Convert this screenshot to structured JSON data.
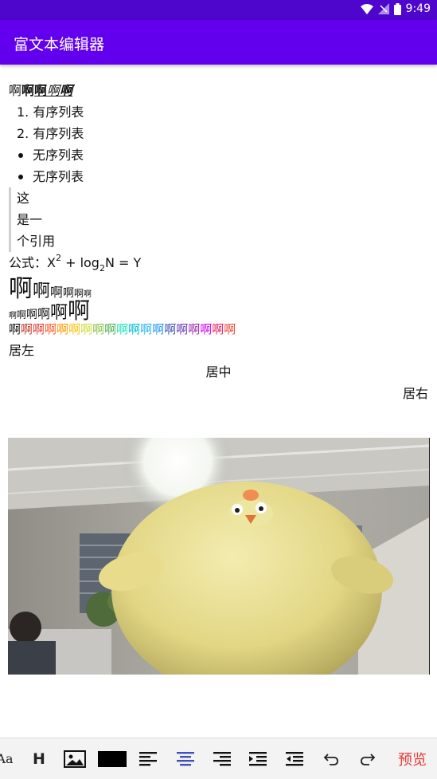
{
  "status": {
    "time": "9:49"
  },
  "app": {
    "title": "富文本编辑器"
  },
  "editor": {
    "mixed": {
      "normal": "啊",
      "bold": "啊",
      "bold_underline": "啊",
      "italic1": "啊",
      "italic2": "啊"
    },
    "ordered": [
      {
        "num": "1.",
        "text": "有序列表"
      },
      {
        "num": "2.",
        "text": "有序列表"
      }
    ],
    "unordered": [
      "无序列表",
      "无序列表"
    ],
    "quote": [
      "这",
      "是一",
      "个引用"
    ],
    "formula": {
      "prefix": "公式：",
      "X": "X",
      "exp": "2",
      "plus": " + log",
      "sub": "2",
      "rest": "N = Y"
    },
    "shrink": [
      "啊",
      "啊",
      "啊",
      "啊",
      "啊",
      "啊"
    ],
    "grow": [
      "啊",
      "啊",
      "啊",
      "啊",
      "啊",
      "啊"
    ],
    "colored": [
      "啊",
      "啊",
      "啊",
      "啊",
      "啊",
      "啊",
      "啊",
      "啊",
      "啊",
      "啊",
      "啊",
      "啊",
      "啊",
      "啊",
      "啊",
      "啊",
      "啊",
      "啊",
      "啊"
    ],
    "colors": [
      "#111111",
      "#c0392b",
      "#e53935",
      "#ff5722",
      "#ff9800",
      "#ffc107",
      "#cddc39",
      "#8bc34a",
      "#4caf50",
      "#1de9b6",
      "#00bcd4",
      "#29b6f6",
      "#2196f3",
      "#3f51b5",
      "#673ab7",
      "#9c27b0",
      "#d500f9",
      "#e91e63",
      "#f44336"
    ],
    "align_left": "居左",
    "align_center": "居中",
    "align_right": "居右"
  },
  "toolbar": {
    "font_size_label": "Aa",
    "heading_label": "H",
    "preview_label": "预览",
    "color_swatch": "#000000",
    "active_color": "#3f51b5",
    "icons": [
      "font-size-icon",
      "heading-icon",
      "image-icon",
      "text-color-swatch",
      "align-left-icon",
      "align-center-icon",
      "align-right-icon",
      "indent-icon",
      "outdent-icon",
      "undo-icon",
      "redo-icon"
    ]
  }
}
